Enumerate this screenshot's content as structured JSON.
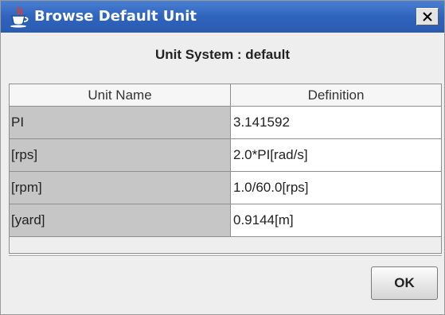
{
  "window": {
    "title": "Browse Default Unit",
    "title_icon": "java-cup-icon",
    "close_label": "×"
  },
  "heading": "Unit System : default",
  "table": {
    "columns": [
      "Unit Name",
      "Definition"
    ],
    "rows": [
      {
        "name": "PI",
        "definition": "3.141592"
      },
      {
        "name": "[rps]",
        "definition": "2.0*PI[rad/s]"
      },
      {
        "name": "[rpm]",
        "definition": "1.0/60.0[rps]"
      },
      {
        "name": "[yard]",
        "definition": "0.9144[m]"
      }
    ]
  },
  "buttons": {
    "ok": "OK"
  },
  "colors": {
    "titlebar": "#2f64bd",
    "name_cell_bg": "#c6c6c6",
    "definition_cell_bg": "#ffffff",
    "dialog_bg": "#eeeeee"
  }
}
